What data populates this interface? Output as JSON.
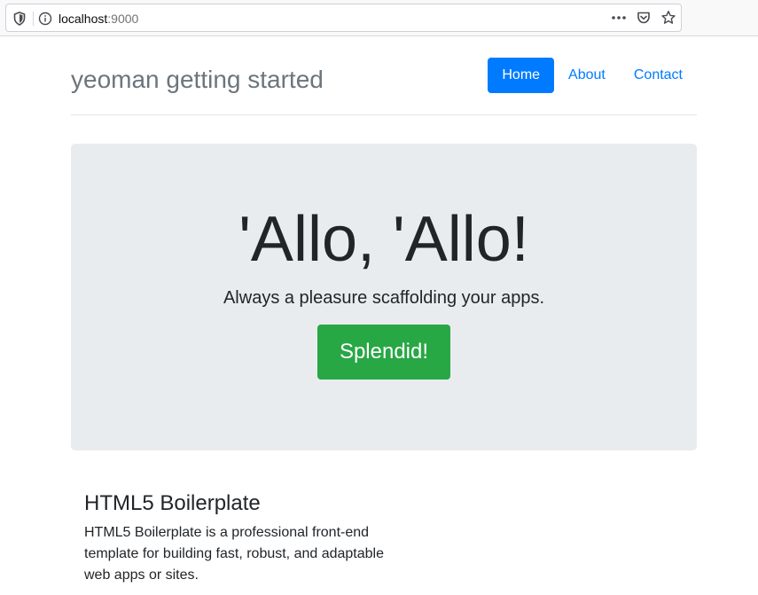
{
  "browser": {
    "url_host": "localhost",
    "url_port": ":9000",
    "icons": [
      "shield-icon",
      "info-icon",
      "more-icon",
      "pocket-icon",
      "star-icon"
    ]
  },
  "header": {
    "brand": "yeoman getting started",
    "nav": [
      {
        "label": "Home",
        "active": true
      },
      {
        "label": "About",
        "active": false
      },
      {
        "label": "Contact",
        "active": false
      }
    ]
  },
  "jumbotron": {
    "title": "'Allo, 'Allo!",
    "lead": "Always a pleasure scaffolding your apps.",
    "button_label": "Splendid!"
  },
  "sections": [
    {
      "title": "HTML5 Boilerplate",
      "text": "HTML5 Boilerplate is a professional front-end template for building fast, robust, and adaptable web apps or sites."
    }
  ],
  "colors": {
    "primary": "#007bff",
    "success": "#28a745",
    "jumbotron_bg": "#e9ecef",
    "brand_text": "#6c757d"
  }
}
